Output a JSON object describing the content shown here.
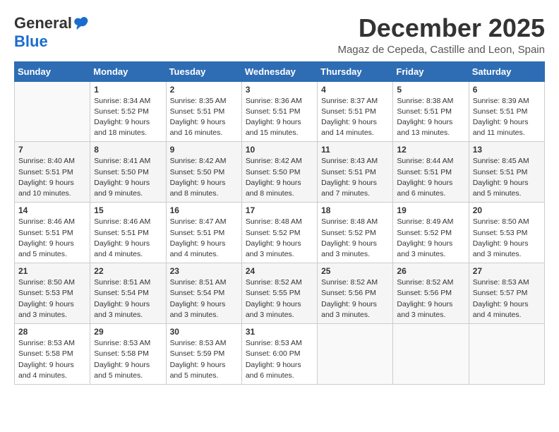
{
  "header": {
    "logo_general": "General",
    "logo_blue": "Blue",
    "month_title": "December 2025",
    "location": "Magaz de Cepeda, Castille and Leon, Spain"
  },
  "days_of_week": [
    "Sunday",
    "Monday",
    "Tuesday",
    "Wednesday",
    "Thursday",
    "Friday",
    "Saturday"
  ],
  "weeks": [
    [
      {
        "day": "",
        "sunrise": "",
        "sunset": "",
        "daylight": ""
      },
      {
        "day": "1",
        "sunrise": "Sunrise: 8:34 AM",
        "sunset": "Sunset: 5:52 PM",
        "daylight": "Daylight: 9 hours and 18 minutes."
      },
      {
        "day": "2",
        "sunrise": "Sunrise: 8:35 AM",
        "sunset": "Sunset: 5:51 PM",
        "daylight": "Daylight: 9 hours and 16 minutes."
      },
      {
        "day": "3",
        "sunrise": "Sunrise: 8:36 AM",
        "sunset": "Sunset: 5:51 PM",
        "daylight": "Daylight: 9 hours and 15 minutes."
      },
      {
        "day": "4",
        "sunrise": "Sunrise: 8:37 AM",
        "sunset": "Sunset: 5:51 PM",
        "daylight": "Daylight: 9 hours and 14 minutes."
      },
      {
        "day": "5",
        "sunrise": "Sunrise: 8:38 AM",
        "sunset": "Sunset: 5:51 PM",
        "daylight": "Daylight: 9 hours and 13 minutes."
      },
      {
        "day": "6",
        "sunrise": "Sunrise: 8:39 AM",
        "sunset": "Sunset: 5:51 PM",
        "daylight": "Daylight: 9 hours and 11 minutes."
      }
    ],
    [
      {
        "day": "7",
        "sunrise": "Sunrise: 8:40 AM",
        "sunset": "Sunset: 5:51 PM",
        "daylight": "Daylight: 9 hours and 10 minutes."
      },
      {
        "day": "8",
        "sunrise": "Sunrise: 8:41 AM",
        "sunset": "Sunset: 5:50 PM",
        "daylight": "Daylight: 9 hours and 9 minutes."
      },
      {
        "day": "9",
        "sunrise": "Sunrise: 8:42 AM",
        "sunset": "Sunset: 5:50 PM",
        "daylight": "Daylight: 9 hours and 8 minutes."
      },
      {
        "day": "10",
        "sunrise": "Sunrise: 8:42 AM",
        "sunset": "Sunset: 5:50 PM",
        "daylight": "Daylight: 9 hours and 8 minutes."
      },
      {
        "day": "11",
        "sunrise": "Sunrise: 8:43 AM",
        "sunset": "Sunset: 5:51 PM",
        "daylight": "Daylight: 9 hours and 7 minutes."
      },
      {
        "day": "12",
        "sunrise": "Sunrise: 8:44 AM",
        "sunset": "Sunset: 5:51 PM",
        "daylight": "Daylight: 9 hours and 6 minutes."
      },
      {
        "day": "13",
        "sunrise": "Sunrise: 8:45 AM",
        "sunset": "Sunset: 5:51 PM",
        "daylight": "Daylight: 9 hours and 5 minutes."
      }
    ],
    [
      {
        "day": "14",
        "sunrise": "Sunrise: 8:46 AM",
        "sunset": "Sunset: 5:51 PM",
        "daylight": "Daylight: 9 hours and 5 minutes."
      },
      {
        "day": "15",
        "sunrise": "Sunrise: 8:46 AM",
        "sunset": "Sunset: 5:51 PM",
        "daylight": "Daylight: 9 hours and 4 minutes."
      },
      {
        "day": "16",
        "sunrise": "Sunrise: 8:47 AM",
        "sunset": "Sunset: 5:51 PM",
        "daylight": "Daylight: 9 hours and 4 minutes."
      },
      {
        "day": "17",
        "sunrise": "Sunrise: 8:48 AM",
        "sunset": "Sunset: 5:52 PM",
        "daylight": "Daylight: 9 hours and 3 minutes."
      },
      {
        "day": "18",
        "sunrise": "Sunrise: 8:48 AM",
        "sunset": "Sunset: 5:52 PM",
        "daylight": "Daylight: 9 hours and 3 minutes."
      },
      {
        "day": "19",
        "sunrise": "Sunrise: 8:49 AM",
        "sunset": "Sunset: 5:52 PM",
        "daylight": "Daylight: 9 hours and 3 minutes."
      },
      {
        "day": "20",
        "sunrise": "Sunrise: 8:50 AM",
        "sunset": "Sunset: 5:53 PM",
        "daylight": "Daylight: 9 hours and 3 minutes."
      }
    ],
    [
      {
        "day": "21",
        "sunrise": "Sunrise: 8:50 AM",
        "sunset": "Sunset: 5:53 PM",
        "daylight": "Daylight: 9 hours and 3 minutes."
      },
      {
        "day": "22",
        "sunrise": "Sunrise: 8:51 AM",
        "sunset": "Sunset: 5:54 PM",
        "daylight": "Daylight: 9 hours and 3 minutes."
      },
      {
        "day": "23",
        "sunrise": "Sunrise: 8:51 AM",
        "sunset": "Sunset: 5:54 PM",
        "daylight": "Daylight: 9 hours and 3 minutes."
      },
      {
        "day": "24",
        "sunrise": "Sunrise: 8:52 AM",
        "sunset": "Sunset: 5:55 PM",
        "daylight": "Daylight: 9 hours and 3 minutes."
      },
      {
        "day": "25",
        "sunrise": "Sunrise: 8:52 AM",
        "sunset": "Sunset: 5:56 PM",
        "daylight": "Daylight: 9 hours and 3 minutes."
      },
      {
        "day": "26",
        "sunrise": "Sunrise: 8:52 AM",
        "sunset": "Sunset: 5:56 PM",
        "daylight": "Daylight: 9 hours and 3 minutes."
      },
      {
        "day": "27",
        "sunrise": "Sunrise: 8:53 AM",
        "sunset": "Sunset: 5:57 PM",
        "daylight": "Daylight: 9 hours and 4 minutes."
      }
    ],
    [
      {
        "day": "28",
        "sunrise": "Sunrise: 8:53 AM",
        "sunset": "Sunset: 5:58 PM",
        "daylight": "Daylight: 9 hours and 4 minutes."
      },
      {
        "day": "29",
        "sunrise": "Sunrise: 8:53 AM",
        "sunset": "Sunset: 5:58 PM",
        "daylight": "Daylight: 9 hours and 5 minutes."
      },
      {
        "day": "30",
        "sunrise": "Sunrise: 8:53 AM",
        "sunset": "Sunset: 5:59 PM",
        "daylight": "Daylight: 9 hours and 5 minutes."
      },
      {
        "day": "31",
        "sunrise": "Sunrise: 8:53 AM",
        "sunset": "Sunset: 6:00 PM",
        "daylight": "Daylight: 9 hours and 6 minutes."
      },
      {
        "day": "",
        "sunrise": "",
        "sunset": "",
        "daylight": ""
      },
      {
        "day": "",
        "sunrise": "",
        "sunset": "",
        "daylight": ""
      },
      {
        "day": "",
        "sunrise": "",
        "sunset": "",
        "daylight": ""
      }
    ]
  ]
}
